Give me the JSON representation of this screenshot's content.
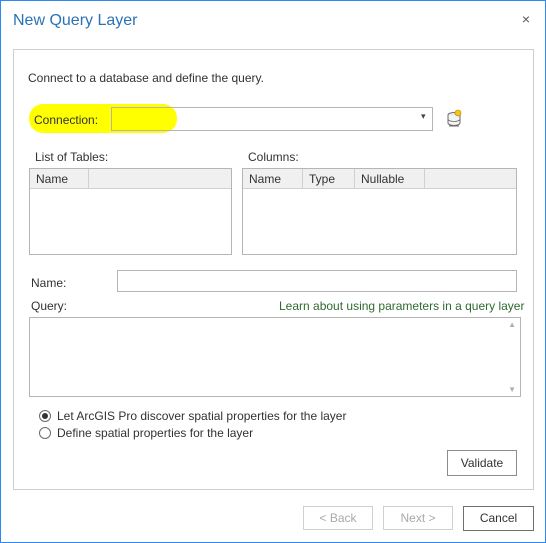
{
  "dialog": {
    "title": "New Query Layer",
    "close_symbol": "×"
  },
  "intro_text": "Connect to a database and define the query.",
  "connection": {
    "label": "Connection:",
    "value": "",
    "dropdown_symbol": "▾"
  },
  "tables": {
    "label": "List of Tables:",
    "columns": [
      "Name"
    ]
  },
  "columns_panel": {
    "label": "Columns:",
    "columns": [
      "Name",
      "Type",
      "Nullable"
    ]
  },
  "name_field": {
    "label": "Name:",
    "value": ""
  },
  "query": {
    "label": "Query:",
    "link": "Learn about using parameters in a query layer",
    "value": ""
  },
  "spatial_options": [
    {
      "label": "Let ArcGIS Pro discover spatial properties for the layer",
      "checked": true
    },
    {
      "label": "Define spatial properties for the layer",
      "checked": false
    }
  ],
  "buttons": {
    "validate": "Validate",
    "back": "< Back",
    "next": "Next >",
    "cancel": "Cancel"
  },
  "colors": {
    "title": "#2a72b5",
    "highlight": "#ffff00",
    "link": "#2e6b2e"
  }
}
